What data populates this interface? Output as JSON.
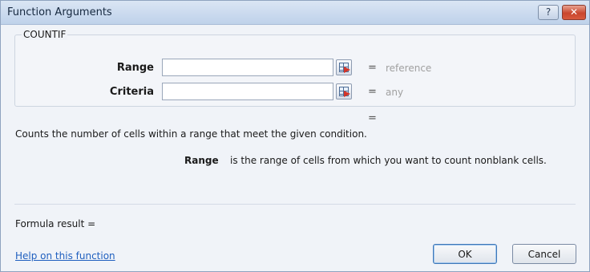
{
  "window": {
    "title": "Function Arguments",
    "help_glyph": "?",
    "close_glyph": "✕"
  },
  "function": {
    "name": "COUNTIF",
    "arguments": [
      {
        "label": "Range",
        "value": "",
        "hint": "reference"
      },
      {
        "label": "Criteria",
        "value": "",
        "hint": "any"
      }
    ],
    "result_equals": "="
  },
  "description": {
    "summary": "Counts the number of cells within a range that meet the given condition.",
    "argument_name": "Range",
    "argument_text": "is the range of cells from which you want to count nonblank cells."
  },
  "footer": {
    "formula_result": "Formula result =",
    "help_link": "Help on this function",
    "ok_label": "OK",
    "cancel_label": "Cancel"
  },
  "icons": {
    "help": "help-icon",
    "close": "close-icon",
    "ref_edit": "collapse-dialog-icon"
  },
  "colors": {
    "titlebar": "#c9d9ee",
    "close_button": "#c9462d",
    "link": "#1f5fbf",
    "hint_text": "#a0a0a0"
  }
}
